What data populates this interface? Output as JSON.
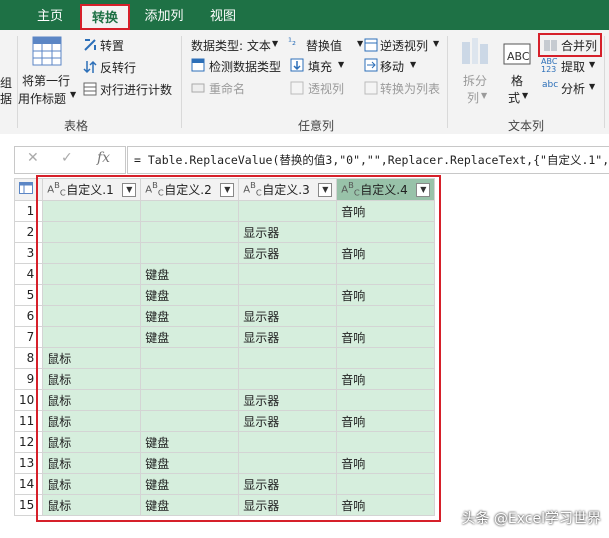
{
  "tabs": [
    "主页",
    "转换",
    "添加列",
    "视图"
  ],
  "ribbon": {
    "left_partial_1": "组",
    "left_partial_2": "据",
    "table_group": {
      "use_first_row": "将第一行",
      "use_first_row_2": "用作标题",
      "transpose": "转置",
      "reverse_rows": "反转行",
      "count_rows": "对行进行计数",
      "label": "表格"
    },
    "any_column_group": {
      "data_type": "数据类型: 文本",
      "detect_type": "检测数据类型",
      "rename": "重命名",
      "replace_values": "替换值",
      "fill": "填充",
      "pivot_column": "透视列",
      "unpivot": "逆透视列",
      "move": "移动",
      "convert_to_list": "转换为列表",
      "label": "任意列"
    },
    "text_column_group": {
      "split_column": "拆分",
      "split_column_2": "列",
      "format": "格",
      "format_2": "式",
      "merge_columns": "合并列",
      "extract": "提取",
      "parse": "分析",
      "label": "文本列"
    }
  },
  "formula": {
    "text": "= Table.ReplaceValue(替换的值3,\"0\",\"\",Replacer.ReplaceText,{\"自定义.1\", \""
  },
  "grid": {
    "columns": [
      "自定义.1",
      "自定义.2",
      "自定义.3",
      "自定义.4"
    ],
    "rows": [
      [
        "1",
        "",
        "",
        "",
        "音响"
      ],
      [
        "2",
        "",
        "",
        "显示器",
        ""
      ],
      [
        "3",
        "",
        "",
        "显示器",
        "音响"
      ],
      [
        "4",
        "",
        "键盘",
        "",
        ""
      ],
      [
        "5",
        "",
        "键盘",
        "",
        "音响"
      ],
      [
        "6",
        "",
        "键盘",
        "显示器",
        ""
      ],
      [
        "7",
        "",
        "键盘",
        "显示器",
        "音响"
      ],
      [
        "8",
        "鼠标",
        "",
        "",
        ""
      ],
      [
        "9",
        "鼠标",
        "",
        "",
        "音响"
      ],
      [
        "10",
        "鼠标",
        "",
        "显示器",
        ""
      ],
      [
        "11",
        "鼠标",
        "",
        "显示器",
        "音响"
      ],
      [
        "12",
        "鼠标",
        "键盘",
        "",
        ""
      ],
      [
        "13",
        "鼠标",
        "键盘",
        "",
        "音响"
      ],
      [
        "14",
        "鼠标",
        "键盘",
        "显示器",
        ""
      ],
      [
        "15",
        "鼠标",
        "键盘",
        "显示器",
        "音响"
      ]
    ]
  },
  "watermark": "头条 @Excel学习世界",
  "colors": {
    "accent": "#1e7145",
    "highlight": "#d6202a",
    "cell_selected": "#d6eedd"
  }
}
